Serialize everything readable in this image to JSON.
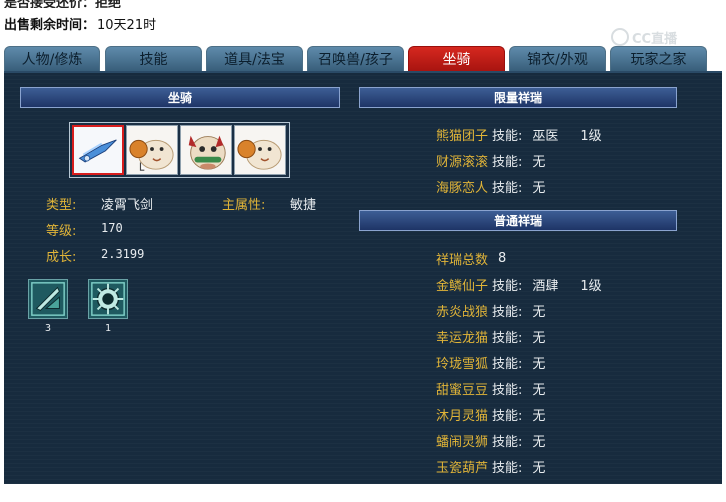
{
  "top": {
    "sale_label": "出售剩余时间：",
    "sale_value": "10天21时"
  },
  "tabs": [
    {
      "label": "人物/修炼",
      "active": false
    },
    {
      "label": "技能",
      "active": false
    },
    {
      "label": "道具/法宝",
      "active": false
    },
    {
      "label": "召唤兽/孩子",
      "active": false
    },
    {
      "label": "坐骑",
      "active": true
    },
    {
      "label": "锦衣/外观",
      "active": false
    },
    {
      "label": "玩家之家",
      "active": false
    }
  ],
  "watermark": "CC直播",
  "mount": {
    "section_title": "坐骑",
    "slots": [
      {
        "icon": "flying-sword-mount-icon",
        "selected": true
      },
      {
        "icon": "sheep-mount-icon",
        "selected": false
      },
      {
        "icon": "horse-mount-icon",
        "selected": false
      },
      {
        "icon": "sheep-mount-icon",
        "selected": false
      }
    ],
    "type_label": "类型:",
    "type_value": "凌霄飞剑",
    "attr_label": "主属性:",
    "attr_value": "敏捷",
    "level_label": "等级:",
    "level_value": "170",
    "growth_label": "成长:",
    "growth_value": "2.3199",
    "skills": [
      {
        "icon": "blade-rune-skill-icon",
        "count": "3"
      },
      {
        "icon": "gear-sun-skill-icon",
        "count": "1"
      }
    ]
  },
  "limited": {
    "section_title": "限量祥瑞",
    "items": [
      {
        "name": "熊猫团子",
        "skill_label": "技能:",
        "skill_value": "巫医",
        "level": "1级"
      },
      {
        "name": "财源滚滚",
        "skill_label": "技能:",
        "skill_value": "无",
        "level": ""
      },
      {
        "name": "海豚恋人",
        "skill_label": "技能:",
        "skill_value": "无",
        "level": ""
      }
    ]
  },
  "normal": {
    "section_title": "普通祥瑞",
    "total_label": "祥瑞总数",
    "total_value": "8",
    "items": [
      {
        "name": "金鳞仙子",
        "skill_label": "技能:",
        "skill_value": "酒肆",
        "level": "1级"
      },
      {
        "name": "赤炎战狼",
        "skill_label": "技能:",
        "skill_value": "无",
        "level": ""
      },
      {
        "name": "幸运龙猫",
        "skill_label": "技能:",
        "skill_value": "无",
        "level": ""
      },
      {
        "name": "玲珑雪狐",
        "skill_label": "技能:",
        "skill_value": "无",
        "level": ""
      },
      {
        "name": "甜蜜豆豆",
        "skill_label": "技能:",
        "skill_value": "无",
        "level": ""
      },
      {
        "name": "沐月灵猫",
        "skill_label": "技能:",
        "skill_value": "无",
        "level": ""
      },
      {
        "name": "蟠闹灵狮",
        "skill_label": "技能:",
        "skill_value": "无",
        "level": ""
      },
      {
        "name": "玉瓷葫芦",
        "skill_label": "技能:",
        "skill_value": "无",
        "level": ""
      }
    ]
  },
  "colors": {
    "panel_bg": "#172b3e",
    "active_tab": "#c91d17",
    "label_gold": "#e0b438",
    "section_bar": "#2d4b80"
  }
}
